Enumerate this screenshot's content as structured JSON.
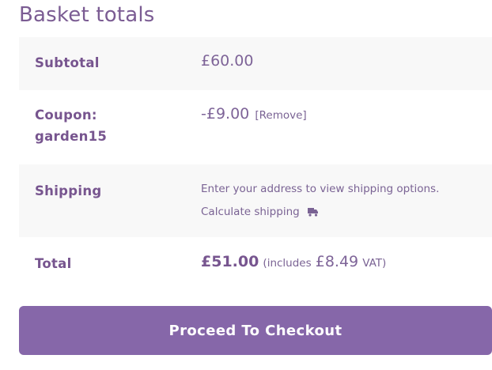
{
  "title": "Basket totals",
  "rows": {
    "subtotal": {
      "label": "Subtotal",
      "value": "£60.00"
    },
    "coupon": {
      "label_line1": "Coupon:",
      "label_line2": "garden15",
      "value": "-£9.00",
      "remove_link": "[Remove]"
    },
    "shipping": {
      "label": "Shipping",
      "message": "Enter your address to view shipping options.",
      "calculate_link": "Calculate shipping",
      "icon": "truck-icon"
    },
    "total": {
      "label": "Total",
      "amount": "£51.00",
      "includes_prefix": "(includes",
      "vat_amount": "£8.49",
      "vat_suffix": "VAT)"
    }
  },
  "checkout_button": "Proceed To Checkout",
  "colors": {
    "accent": "#8667a9",
    "text": "#7b5c93",
    "row_shade": "#f8f8f8"
  }
}
